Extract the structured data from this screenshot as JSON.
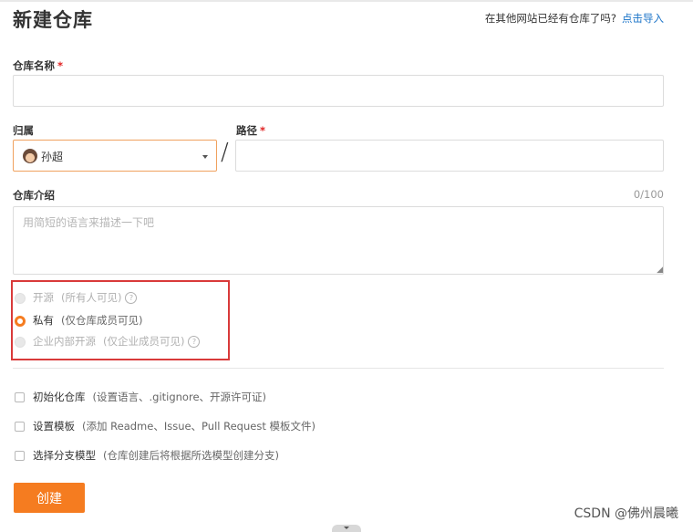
{
  "header": {
    "title": "新建仓库",
    "import_prompt": "在其他网站已经有仓库了吗?",
    "import_link": "点击导入"
  },
  "repo_name": {
    "label": "仓库名称",
    "required_mark": "*",
    "value": ""
  },
  "owner": {
    "label": "归属",
    "selected": "孙超"
  },
  "path": {
    "label": "路径",
    "required_mark": "*",
    "separator": "/",
    "value": ""
  },
  "description": {
    "label": "仓库介绍",
    "counter": "0/100",
    "placeholder": "用简短的语言来描述一下吧",
    "value": ""
  },
  "visibility": {
    "options": [
      {
        "label": "开源",
        "note": "(所有人可见)",
        "help": "?",
        "selected": false,
        "disabled": true
      },
      {
        "label": "私有",
        "note": "(仅仓库成员可见)",
        "selected": true,
        "disabled": false
      },
      {
        "label": "企业内部开源",
        "note": "(仅企业成员可见)",
        "help": "?",
        "selected": false,
        "disabled": true
      }
    ]
  },
  "init_options": [
    {
      "label": "初始化仓库",
      "note": "(设置语言、.gitignore、开源许可证)",
      "checked": false
    },
    {
      "label": "设置模板",
      "note": "(添加 Readme、Issue、Pull Request 模板文件)",
      "checked": false
    },
    {
      "label": "选择分支模型",
      "note": "(仓库创建后将根据所选模型创建分支)",
      "checked": false
    }
  ],
  "submit": {
    "label": "创建"
  },
  "watermark": "CSDN @佛州晨曦",
  "colors": {
    "accent": "#f57c20",
    "link": "#1a73c8",
    "required": "#e02020",
    "highlight_box": "#d93a3a"
  }
}
